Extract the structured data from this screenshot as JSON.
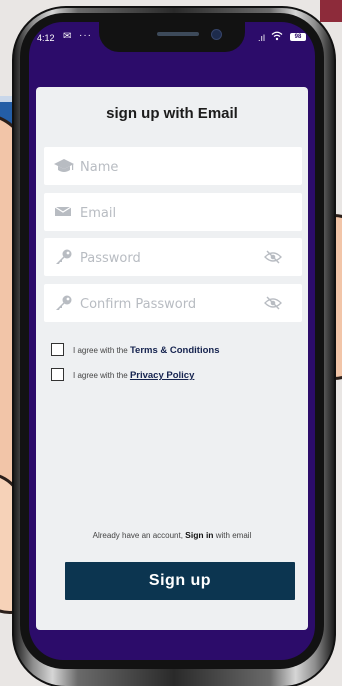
{
  "status_bar": {
    "time": "4:12",
    "mail_icon": "✉",
    "dots": "···",
    "signal": ".ıl",
    "wifi_icon": "wifi-icon",
    "battery": "98"
  },
  "form": {
    "title": "sign up with Email",
    "fields": [
      {
        "placeholder": "Name",
        "icon": "graduation-cap-icon"
      },
      {
        "placeholder": "Email",
        "icon": "envelope-icon"
      },
      {
        "placeholder": "Password",
        "icon": "key-icon",
        "toggle_icon": "eye-slash-icon"
      },
      {
        "placeholder": "Confirm Password",
        "icon": "key-icon",
        "toggle_icon": "eye-slash-icon"
      }
    ],
    "terms": {
      "prefix": "I agree with the",
      "link": "Terms & Conditions"
    },
    "privacy": {
      "prefix": "I agree with the",
      "link": "Privacy Policy"
    },
    "already": {
      "before": "Already have an account,",
      "link": "Sign in",
      "after": "with email"
    },
    "submit_label": "Sign up"
  },
  "colors": {
    "screen_background": "#2c0c6a",
    "card_background": "#eef0f2",
    "button_background": "#0c3550",
    "link_color": "#15234f"
  }
}
